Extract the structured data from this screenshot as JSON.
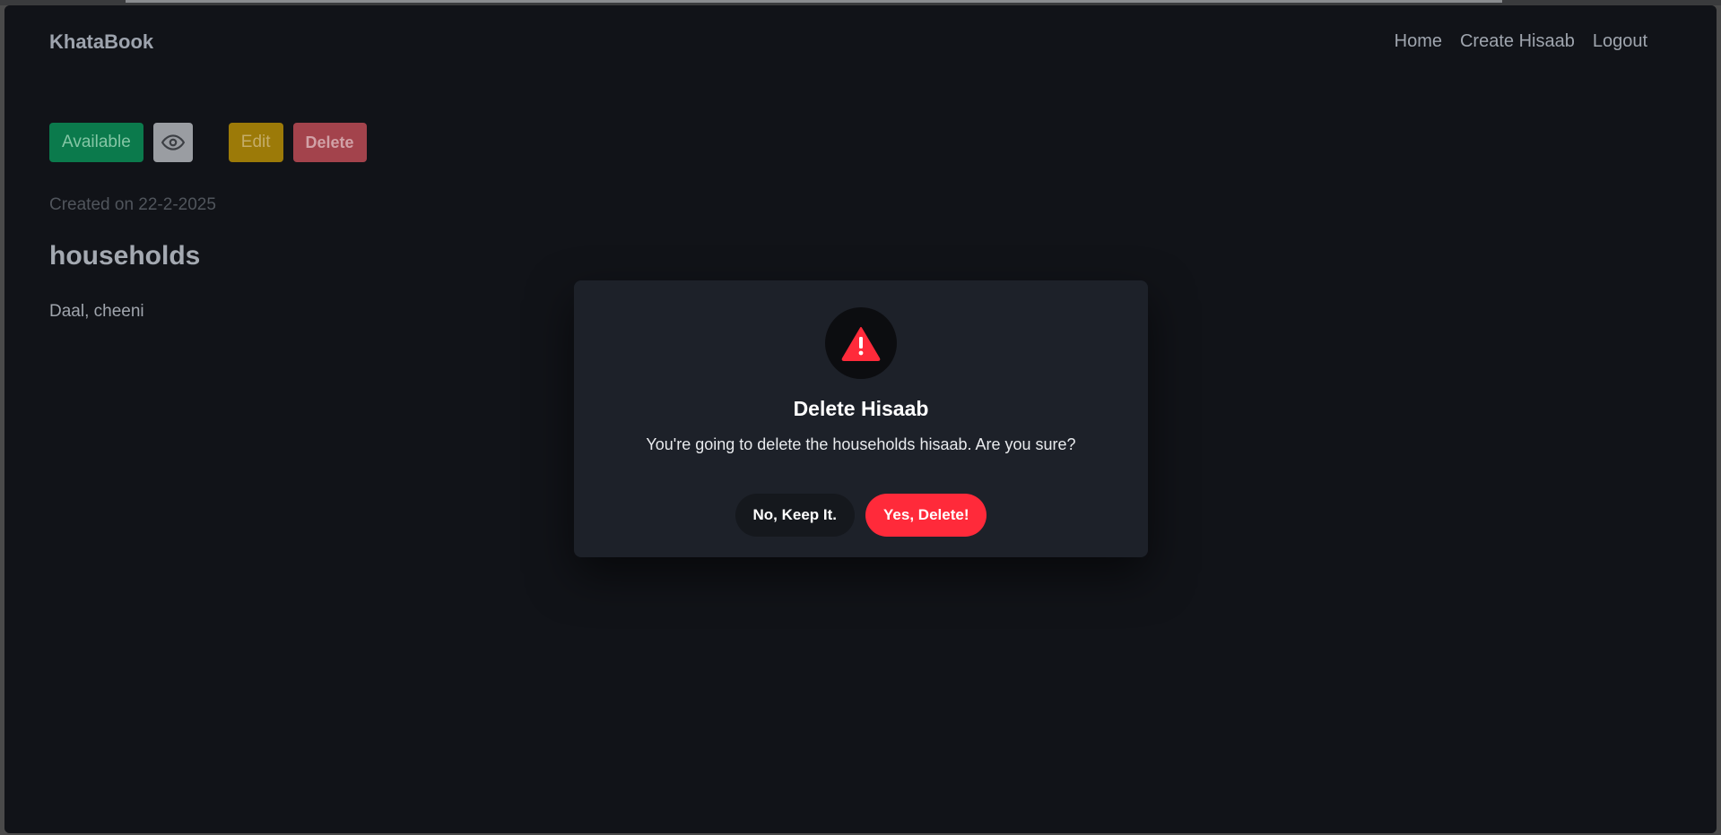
{
  "navbar": {
    "brand": "KhataBook",
    "links": [
      "Home",
      "Create Hisaab",
      "Logout"
    ]
  },
  "toolbar": {
    "available_label": "Available",
    "edit_label": "Edit",
    "delete_label": "Delete",
    "view_icon": "eye-icon"
  },
  "hisaab": {
    "created": "Created on 22-2-2025",
    "title": "households",
    "description": "Daal, cheeni"
  },
  "modal": {
    "icon": "warning-icon",
    "title": "Delete Hisaab",
    "message": "You're going to delete the households hisaab. Are you sure?",
    "cancel_label": "No, Keep It.",
    "confirm_label": "Yes, Delete!"
  },
  "colors": {
    "available": "#0b7a4c",
    "edit": "#9c7a08",
    "delete": "#a3434c",
    "danger": "#ff2a3a",
    "background": "#111318",
    "modal": "#1d2129"
  }
}
